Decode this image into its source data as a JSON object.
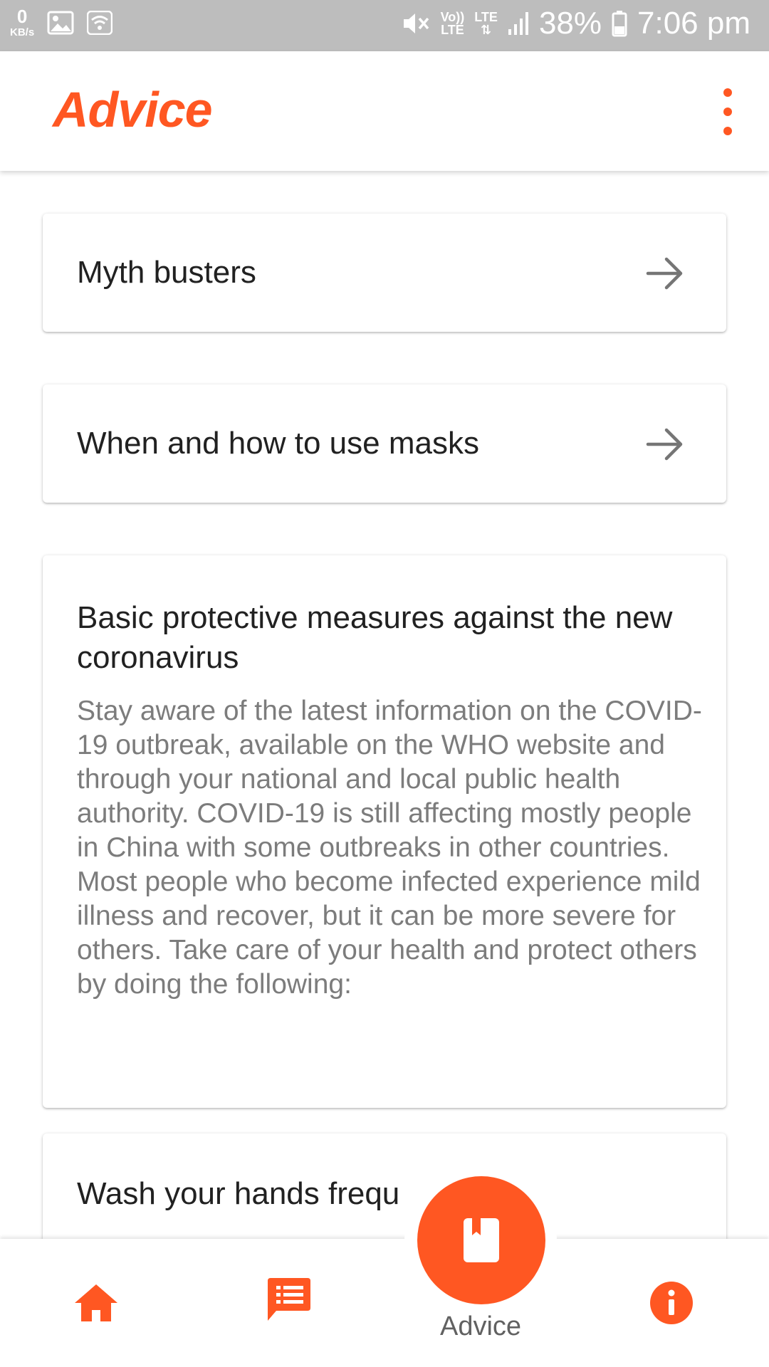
{
  "status_bar": {
    "data_rate": "0",
    "data_unit": "KB/s",
    "volte_top": "Vo))",
    "volte_bottom": "LTE",
    "network": "LTE",
    "battery": "38%",
    "time": "7:06 pm",
    "icons": [
      "image-icon",
      "wifi-icon",
      "mute-icon",
      "signal-icon",
      "battery-icon"
    ]
  },
  "app_bar": {
    "title": "Advice",
    "menu_icon": "more-vert-icon"
  },
  "cards": {
    "myth_busters": {
      "label": "Myth busters",
      "icon": "arrow-right-icon"
    },
    "masks": {
      "label": "When and how to use masks",
      "icon": "arrow-right-icon"
    },
    "basic_measures": {
      "title": "Basic protective measures against the new coronavirus",
      "body": "Stay aware of the latest information on the COVID-19 outbreak, available on the WHO website and through your national and local public health authority. COVID-19 is still affecting mostly people in China with some outbreaks in other countries. Most people who become infected experience mild illness and recover, but it can be more severe for others. Take care of your health and protect others by doing the following:"
    },
    "wash_hands": {
      "title": "Wash your hands frequ"
    }
  },
  "bottom_nav": {
    "items": [
      {
        "icon": "home-icon"
      },
      {
        "icon": "chat-icon"
      },
      {
        "icon": "book-icon",
        "label": "Advice",
        "active": true
      },
      {
        "icon": "info-icon"
      }
    ]
  },
  "colors": {
    "accent": "#ff5722",
    "status_bar": "#bdbdbd",
    "text_primary": "#212121",
    "text_secondary": "#7c7c7c"
  }
}
